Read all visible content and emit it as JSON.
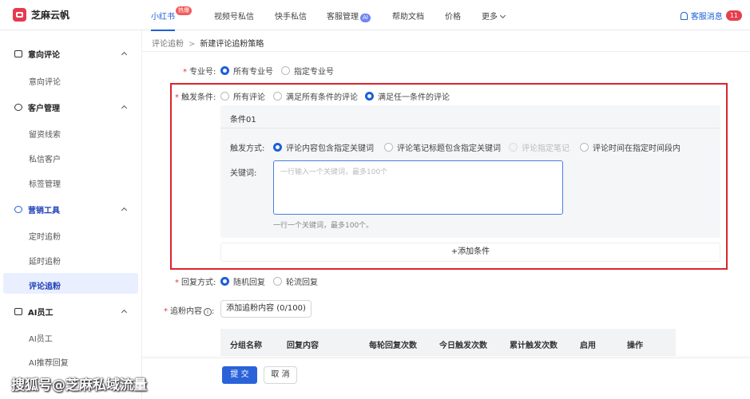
{
  "app": {
    "name": "芝麻云帆"
  },
  "nav": {
    "tabs": [
      {
        "label": "小红书",
        "badge": "热爆"
      },
      {
        "label": "视频号私信"
      },
      {
        "label": "快手私信"
      },
      {
        "label": "客服管理",
        "badge": "AI"
      },
      {
        "label": "帮助文档"
      },
      {
        "label": "价格"
      },
      {
        "label": "更多"
      }
    ],
    "notify": {
      "label": "客服消息",
      "count": "11"
    }
  },
  "sidebar": {
    "sections": [
      {
        "label": "意向评论",
        "items": [
          "意向评论"
        ]
      },
      {
        "label": "客户管理",
        "items": [
          "留资线索",
          "私信客户",
          "标签管理"
        ]
      },
      {
        "label": "营销工具",
        "items": [
          "定时追粉",
          "延时追粉",
          "评论追粉"
        ]
      },
      {
        "label": "AI员工",
        "items": [
          "AI员工",
          "AI推荐回复"
        ]
      }
    ]
  },
  "breadcrumb": {
    "parent": "评论追粉",
    "current": "新建评论追粉策略"
  },
  "form": {
    "account": {
      "label": "专业号:",
      "options": [
        "所有专业号",
        "指定专业号"
      ]
    },
    "trigger": {
      "label": "触发条件:",
      "options": [
        "所有评论",
        "满足所有条件的评论",
        "满足任一条件的评论"
      ]
    },
    "condition": {
      "title": "条件01",
      "method_label": "触发方式:",
      "methods": [
        "评论内容包含指定关键词",
        "评论笔记标题包含指定关键词",
        "评论指定笔记",
        "评论时间在指定时间段内"
      ],
      "keyword_label": "关键词:",
      "keyword_placeholder": "一行输入一个关键词，最多100个",
      "hint": "一行一个关键词，最多100个。",
      "add_button": "+添加条件"
    },
    "reply": {
      "label": "回复方式:",
      "options": [
        "随机回复",
        "轮流回复"
      ]
    },
    "content": {
      "label": "追粉内容",
      "info": "i",
      "add_button": "添加追粉内容 (0/100)"
    },
    "table_headers": [
      "分组名称",
      "回复内容",
      "每轮回复次数",
      "今日触发次数",
      "累计触发次数",
      "启用",
      "操作"
    ]
  },
  "footer": {
    "submit": "提 交",
    "cancel": "取 消"
  },
  "watermark": "搜狐号@芝麻私域流量"
}
